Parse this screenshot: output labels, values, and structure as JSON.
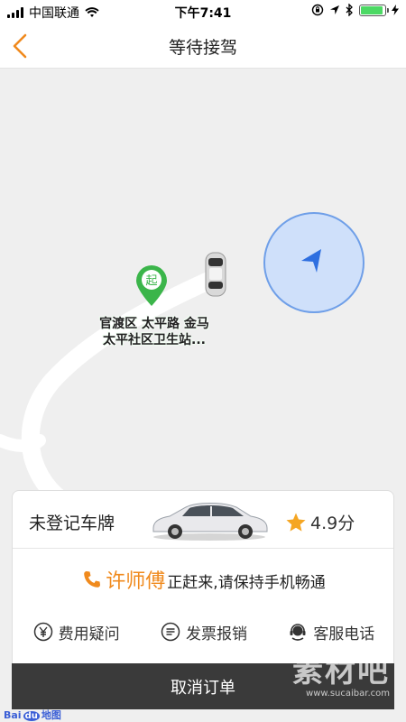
{
  "status_bar": {
    "carrier": "中国联通",
    "time": "下午7:41"
  },
  "nav": {
    "title": "等待接驾"
  },
  "map": {
    "pickup_marker_text": "起",
    "pickup_label_line1": "官渡区 太平路 金马",
    "pickup_label_line2": "太平社区卫生站..."
  },
  "card": {
    "plate": "未登记车牌",
    "rating": "4.9分",
    "driver_name": "许师傅",
    "driver_message": "正赶来,请保持手机畅通",
    "actions": [
      {
        "label": "费用疑问",
        "icon": "yen-icon"
      },
      {
        "label": "发票报销",
        "icon": "invoice-icon"
      },
      {
        "label": "客服电话",
        "icon": "headset-icon"
      }
    ],
    "cancel_label": "取消订单"
  },
  "watermarks": {
    "baidu": "Bai",
    "baidu_du": "du",
    "baidu_map": "地图",
    "site_name": "素材吧",
    "site_url": "www.sucaibar.com"
  },
  "colors": {
    "accent": "#f08a1d",
    "marker_green": "#3bb54a",
    "location_blue": "#2e6fe0"
  }
}
